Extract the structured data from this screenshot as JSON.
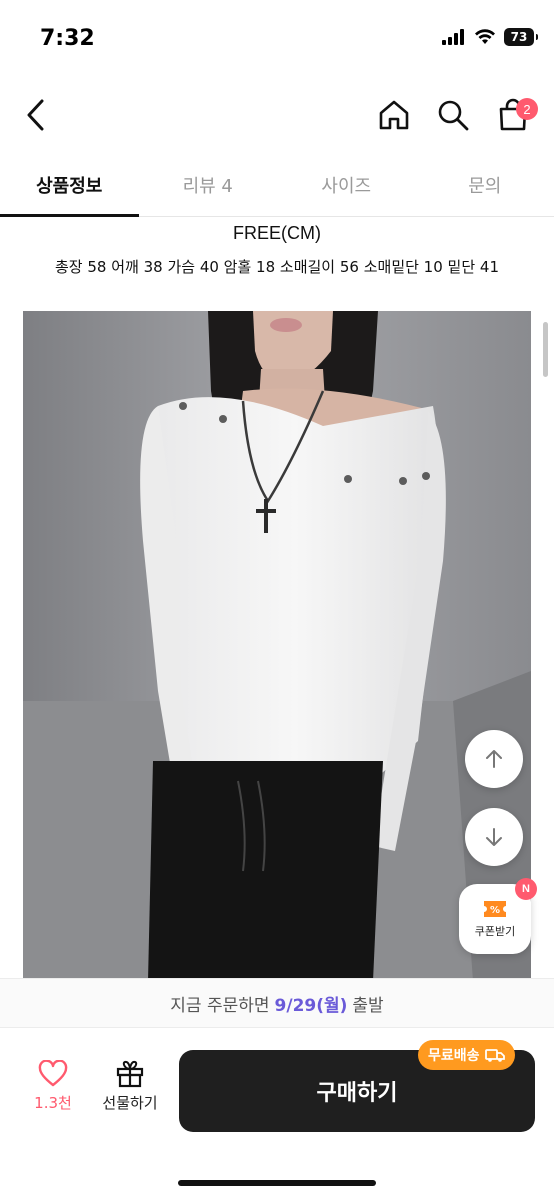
{
  "status_bar": {
    "time": "7:32",
    "battery": "73"
  },
  "nav": {
    "cart_count": "2"
  },
  "tabs": [
    {
      "label": "상품정보",
      "active": true
    },
    {
      "label": "리뷰 4",
      "active": false
    },
    {
      "label": "사이즈",
      "active": false
    },
    {
      "label": "문의",
      "active": false
    }
  ],
  "size_info": {
    "title": "FREE(CM)",
    "detail": "총장 58 어깨 38 가슴 40 암홀 18 소매길이 56 소매밑단 10 밑단 41"
  },
  "coupon": {
    "label": "쿠폰받기",
    "badge": "N"
  },
  "delivery": {
    "prefix": "지금 주문하면",
    "date": "9/29(월)",
    "suffix": "출발"
  },
  "bottom_bar": {
    "like_count": "1.3천",
    "gift_label": "선물하기",
    "buy_label": "구매하기",
    "free_shipping": "무료배송"
  },
  "colors": {
    "accent_pink": "#ff5a6e",
    "delivery_purple": "#6a5ad8",
    "badge_orange": "#ff9a1f",
    "buy_button": "#1f1f1f"
  }
}
